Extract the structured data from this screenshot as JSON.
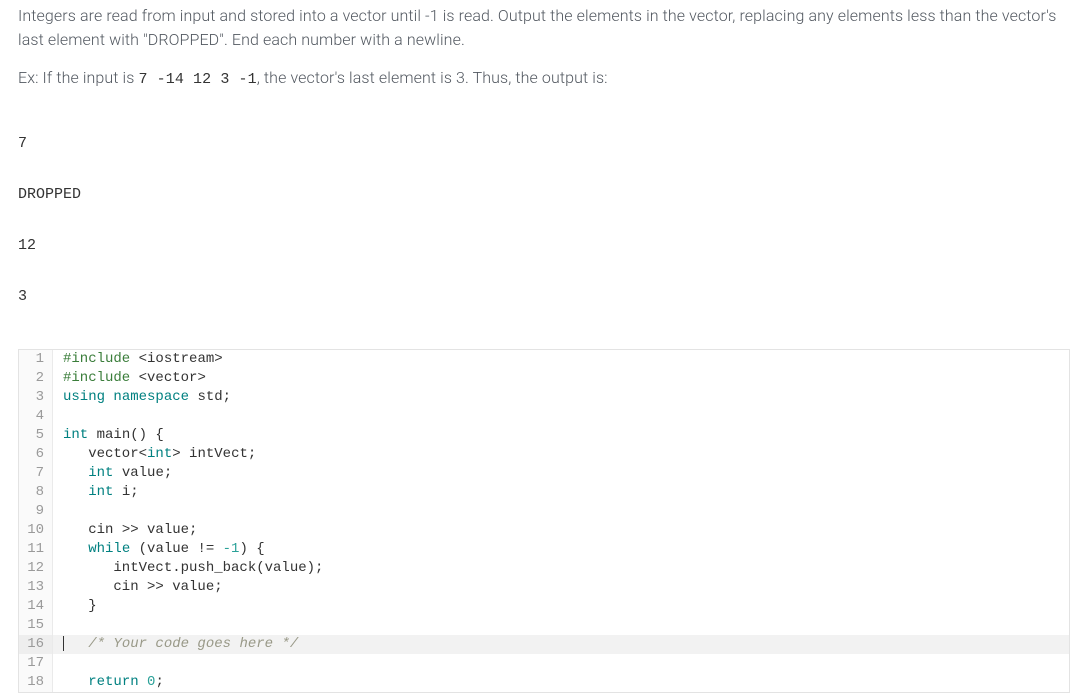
{
  "problem": {
    "paragraph1": "Integers are read from input and stored into a vector until -1 is read. Output the elements in the vector, replacing any elements less than the vector's last element with \"DROPPED\". End each number with a newline.",
    "example_prefix": "Ex: If the input is ",
    "example_input": "7 -14 12 3 -1",
    "example_suffix": ", the vector's last element is 3. Thus, the output is:",
    "output_lines": [
      "7",
      "DROPPED",
      "12",
      "3"
    ]
  },
  "code": {
    "highlight_line": 16,
    "lines": [
      {
        "n": 1,
        "tokens": [
          [
            "pre",
            "#include"
          ],
          [
            "",
            " "
          ],
          [
            "op",
            "<"
          ],
          [
            "",
            "iostream"
          ],
          [
            "op",
            ">"
          ]
        ]
      },
      {
        "n": 2,
        "tokens": [
          [
            "pre",
            "#include"
          ],
          [
            "",
            " "
          ],
          [
            "op",
            "<"
          ],
          [
            "",
            "vector"
          ],
          [
            "op",
            ">"
          ]
        ]
      },
      {
        "n": 3,
        "tokens": [
          [
            "kw",
            "using"
          ],
          [
            "",
            " "
          ],
          [
            "kw",
            "namespace"
          ],
          [
            "",
            " std;"
          ]
        ]
      },
      {
        "n": 4,
        "tokens": [
          [
            "",
            ""
          ]
        ]
      },
      {
        "n": 5,
        "tokens": [
          [
            "kw",
            "int"
          ],
          [
            "",
            " main() {"
          ]
        ]
      },
      {
        "n": 6,
        "tokens": [
          [
            "",
            "   vector"
          ],
          [
            "op",
            "<"
          ],
          [
            "kw",
            "int"
          ],
          [
            "op",
            ">"
          ],
          [
            "",
            " intVect;"
          ]
        ]
      },
      {
        "n": 7,
        "tokens": [
          [
            "",
            "   "
          ],
          [
            "kw",
            "int"
          ],
          [
            "",
            " value;"
          ]
        ]
      },
      {
        "n": 8,
        "tokens": [
          [
            "",
            "   "
          ],
          [
            "kw",
            "int"
          ],
          [
            "",
            " i;"
          ]
        ]
      },
      {
        "n": 9,
        "tokens": [
          [
            "",
            ""
          ]
        ]
      },
      {
        "n": 10,
        "tokens": [
          [
            "",
            "   cin "
          ],
          [
            "op",
            ">>"
          ],
          [
            "",
            " value;"
          ]
        ]
      },
      {
        "n": 11,
        "tokens": [
          [
            "",
            "   "
          ],
          [
            "kw",
            "while"
          ],
          [
            "",
            " (value != "
          ],
          [
            "num",
            "-1"
          ],
          [
            "",
            ") {"
          ]
        ]
      },
      {
        "n": 12,
        "tokens": [
          [
            "",
            "      intVect.push_back(value);"
          ]
        ]
      },
      {
        "n": 13,
        "tokens": [
          [
            "",
            "      cin "
          ],
          [
            "op",
            ">>"
          ],
          [
            "",
            " value;"
          ]
        ]
      },
      {
        "n": 14,
        "tokens": [
          [
            "",
            "   }"
          ]
        ]
      },
      {
        "n": 15,
        "tokens": [
          [
            "",
            ""
          ]
        ]
      },
      {
        "n": 16,
        "tokens": [
          [
            "",
            "   "
          ],
          [
            "comment",
            "/* Your code goes here */"
          ]
        ]
      },
      {
        "n": 17,
        "tokens": [
          [
            "",
            ""
          ]
        ]
      },
      {
        "n": 18,
        "tokens": [
          [
            "",
            "   "
          ],
          [
            "kw",
            "return"
          ],
          [
            "",
            " "
          ],
          [
            "num",
            "0"
          ],
          [
            "",
            ";"
          ]
        ]
      }
    ]
  }
}
